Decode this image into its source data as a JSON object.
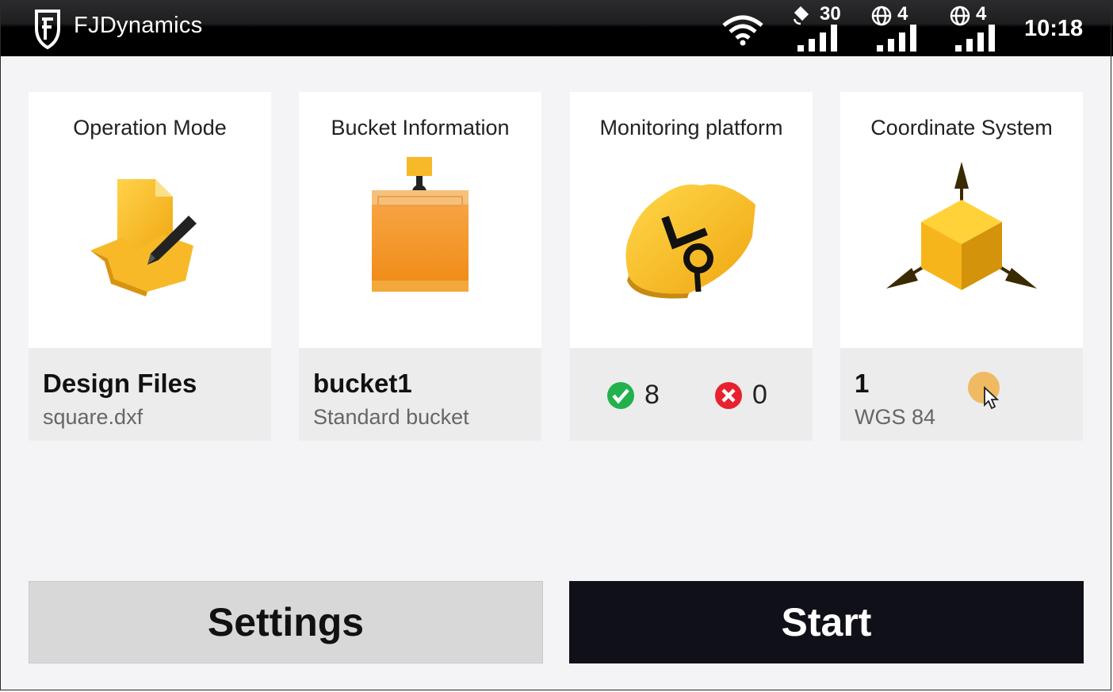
{
  "statusbar": {
    "brand": "FJDynamics",
    "satellite_count": "30",
    "net1_count": "4",
    "net2_count": "4",
    "time": "10:18",
    "icons": [
      "fjd-logo-icon",
      "wifi-icon",
      "satellite-icon",
      "globe-icon",
      "signal-bars-icon"
    ]
  },
  "cards": [
    {
      "title": "Operation Mode",
      "main": "Design Files",
      "sub": "square.dxf",
      "icon": "design-file-icon"
    },
    {
      "title": "Bucket Information",
      "main": "bucket1",
      "sub": "Standard bucket",
      "icon": "bucket-icon"
    },
    {
      "title": "Monitoring platform",
      "ok_count": "8",
      "error_count": "0",
      "icon": "shield-monitor-icon"
    },
    {
      "title": "Coordinate System",
      "main": "1",
      "sub": "WGS 84",
      "icon": "coordinate-cube-icon"
    }
  ],
  "buttons": {
    "settings": "Settings",
    "start": "Start"
  },
  "colors": {
    "accent": "#f5b21b",
    "start_bg": "#101018",
    "settings_bg": "#d8d8d8",
    "ok": "#22b14c",
    "error": "#e8212e"
  }
}
